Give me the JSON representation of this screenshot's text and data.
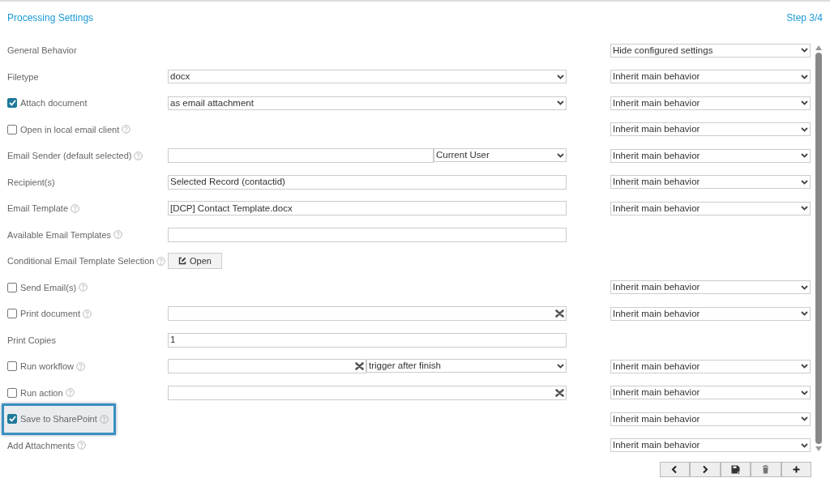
{
  "header": {
    "title": "Processing Settings",
    "step": "Step 3/4"
  },
  "rows": [
    {
      "label": "General Behavior",
      "help": false,
      "highlighted": false,
      "behavior": "Hide configured settings"
    },
    {
      "label": "Filetype",
      "help": false,
      "highlighted": false,
      "control": {
        "kind": "select",
        "value": "docx"
      },
      "behavior": "Inherit main behavior"
    },
    {
      "label": "Attach document",
      "checked": true,
      "help": false,
      "highlighted": false,
      "control": {
        "kind": "select",
        "value": "as email attachment"
      },
      "behavior": "Inherit main behavior"
    },
    {
      "label": "Open in local email client",
      "checked": false,
      "help": true,
      "highlighted": false,
      "behavior": "Inherit main behavior"
    },
    {
      "label": "Email Sender (default selected)",
      "help": true,
      "highlighted": false,
      "control": {
        "kind": "input-select",
        "option": "Current User"
      },
      "behavior": "Inherit main behavior"
    },
    {
      "label": "Recipient(s)",
      "help": false,
      "highlighted": false,
      "control": {
        "kind": "input",
        "value": "Selected Record (contactid)"
      },
      "behavior": "Inherit main behavior"
    },
    {
      "label": "Email Template",
      "help": true,
      "highlighted": false,
      "control": {
        "kind": "input",
        "value": "[DCP] Contact Template.docx"
      },
      "behavior": "Inherit main behavior"
    },
    {
      "label": "Available Email Templates",
      "help": true,
      "highlighted": false,
      "control": {
        "kind": "input"
      }
    },
    {
      "label": "Conditional Email Template Selection",
      "help": true,
      "highlighted": false,
      "control": {
        "kind": "button",
        "value": "Open"
      }
    },
    {
      "label": "Send Email(s)",
      "checked": false,
      "help": true,
      "highlighted": false,
      "behavior": "Inherit main behavior"
    },
    {
      "label": "Print document",
      "checked": false,
      "help": true,
      "highlighted": false,
      "control": {
        "kind": "clearable"
      },
      "behavior": "Inherit main behavior"
    },
    {
      "label": "Print Copies",
      "help": false,
      "highlighted": false,
      "control": {
        "kind": "input",
        "value": "1"
      }
    },
    {
      "label": "Run workflow",
      "checked": false,
      "help": true,
      "highlighted": false,
      "control": {
        "kind": "clearable-select",
        "option": "trigger after finish"
      },
      "behavior": "Inherit main behavior"
    },
    {
      "label": "Run action",
      "checked": false,
      "help": true,
      "highlighted": false,
      "control": {
        "kind": "clearable"
      },
      "behavior": "Inherit main behavior"
    },
    {
      "label": "Save to SharePoint",
      "checked": true,
      "help": true,
      "highlighted": true,
      "behavior": "Inherit main behavior"
    },
    {
      "label": "Add Attachments",
      "help": true,
      "highlighted": false,
      "behavior": "Inherit main behavior"
    }
  ],
  "toolbar": [
    {
      "kind": "previous"
    },
    {
      "kind": "next"
    },
    {
      "kind": "save"
    },
    {
      "kind": "delete"
    },
    {
      "kind": "add"
    }
  ]
}
